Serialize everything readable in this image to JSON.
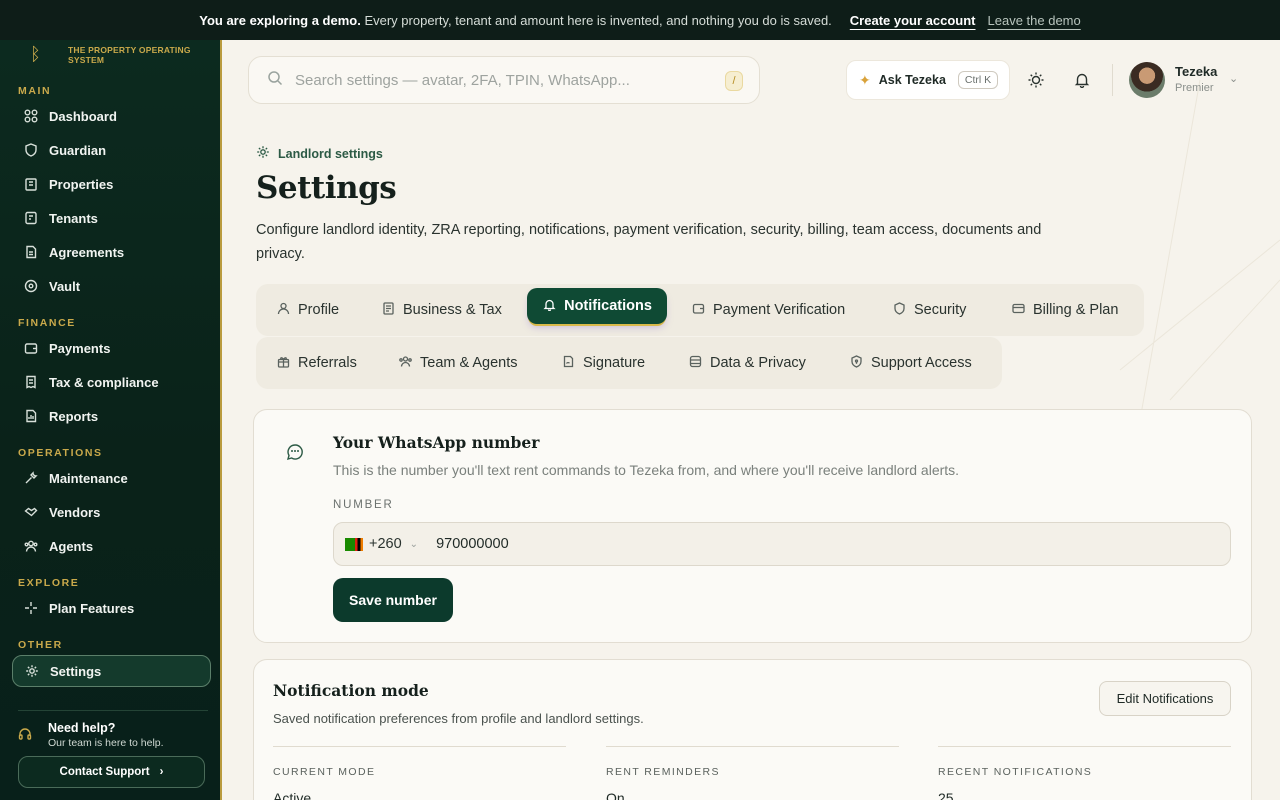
{
  "banner": {
    "lead": "You are exploring a demo.",
    "text": "Every property, tenant and amount here is invented, and nothing you do is saved.",
    "create": "Create your account",
    "leave": "Leave the demo"
  },
  "brand": {
    "tagline": "THE PROPERTY OPERATING SYSTEM"
  },
  "sidebar": {
    "main_label": "MAIN",
    "main": [
      "Dashboard",
      "Guardian",
      "Properties",
      "Tenants",
      "Agreements",
      "Vault"
    ],
    "finance_label": "FINANCE",
    "finance": [
      "Payments",
      "Tax & compliance",
      "Reports"
    ],
    "operations_label": "OPERATIONS",
    "operations": [
      "Maintenance",
      "Vendors",
      "Agents"
    ],
    "explore_label": "EXPLORE",
    "explore": [
      "Plan Features"
    ],
    "other_label": "OTHER",
    "other": [
      "Settings"
    ],
    "help_title": "Need help?",
    "help_sub": "Our team is here to help.",
    "contact": "Contact Support"
  },
  "topbar": {
    "search_placeholder": "Search settings — avatar, 2FA, TPIN, WhatsApp...",
    "search_shortcut": "/",
    "ask": "Ask Tezeka",
    "ask_shortcut": "Ctrl K",
    "user_name": "Tezeka",
    "user_role": "Premier"
  },
  "page": {
    "breadcrumb": "Landlord settings",
    "title": "Settings",
    "description": "Configure landlord identity, ZRA reporting, notifications, payment verification, security, billing, team access, documents and privacy."
  },
  "tabs": {
    "row1": [
      "Profile",
      "Business & Tax",
      "Notifications",
      "Payment Verification",
      "Security",
      "Billing & Plan"
    ],
    "row2": [
      "Referrals",
      "Team & Agents",
      "Signature",
      "Data & Privacy",
      "Support Access"
    ],
    "active": "Notifications"
  },
  "whatsapp": {
    "title": "Your WhatsApp number",
    "description": "This is the number you'll text rent commands to Tezeka from, and where you'll receive landlord alerts.",
    "label": "NUMBER",
    "country_code": "+260",
    "number": "970000000",
    "save": "Save number"
  },
  "notification_mode": {
    "title": "Notification mode",
    "description": "Saved notification preferences from profile and landlord settings.",
    "edit": "Edit Notifications",
    "stats": [
      {
        "label": "CURRENT MODE",
        "value": "Active"
      },
      {
        "label": "RENT REMINDERS",
        "value": "On"
      },
      {
        "label": "RECENT NOTIFICATIONS",
        "value": "25"
      }
    ]
  },
  "colors": {
    "brand_green": "#0c3a2c",
    "gold": "#c9a94b",
    "background": "#f6f3ec"
  }
}
